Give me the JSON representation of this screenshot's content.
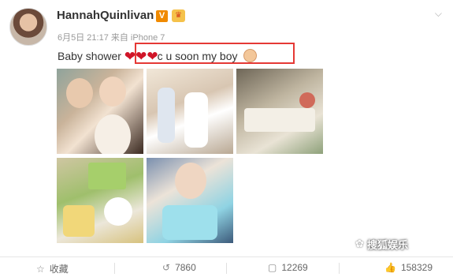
{
  "profile": {
    "name": "HannahQuinlivan",
    "verified_icon": "verified-v-badge",
    "vip_icon": "vip-crown-badge",
    "avatar_icon": "user-avatar"
  },
  "post": {
    "meta": "6月5日 21:17 来自 iPhone 7",
    "text_prefix": "Baby shower",
    "hearts": "❤❤❤",
    "text_suffix": "c u soon my boy",
    "emoji_icon": "baby-face-emoji",
    "menu_icon": "chevron-down-icon"
  },
  "highlight_color": "#e53935",
  "images": [
    {
      "id": "photo-1",
      "alt": "two women posing"
    },
    {
      "id": "photo-2",
      "alt": "women in white dresses"
    },
    {
      "id": "photo-3",
      "alt": "dessert table"
    },
    {
      "id": "photo-4",
      "alt": "cookies and sign"
    },
    {
      "id": "photo-5",
      "alt": "woman with cake"
    }
  ],
  "footer": {
    "favorite_label": "收藏",
    "repost_count": "7860",
    "comment_count": "12269",
    "like_count": "158329"
  },
  "watermark": {
    "text": "搜狐娱乐"
  }
}
